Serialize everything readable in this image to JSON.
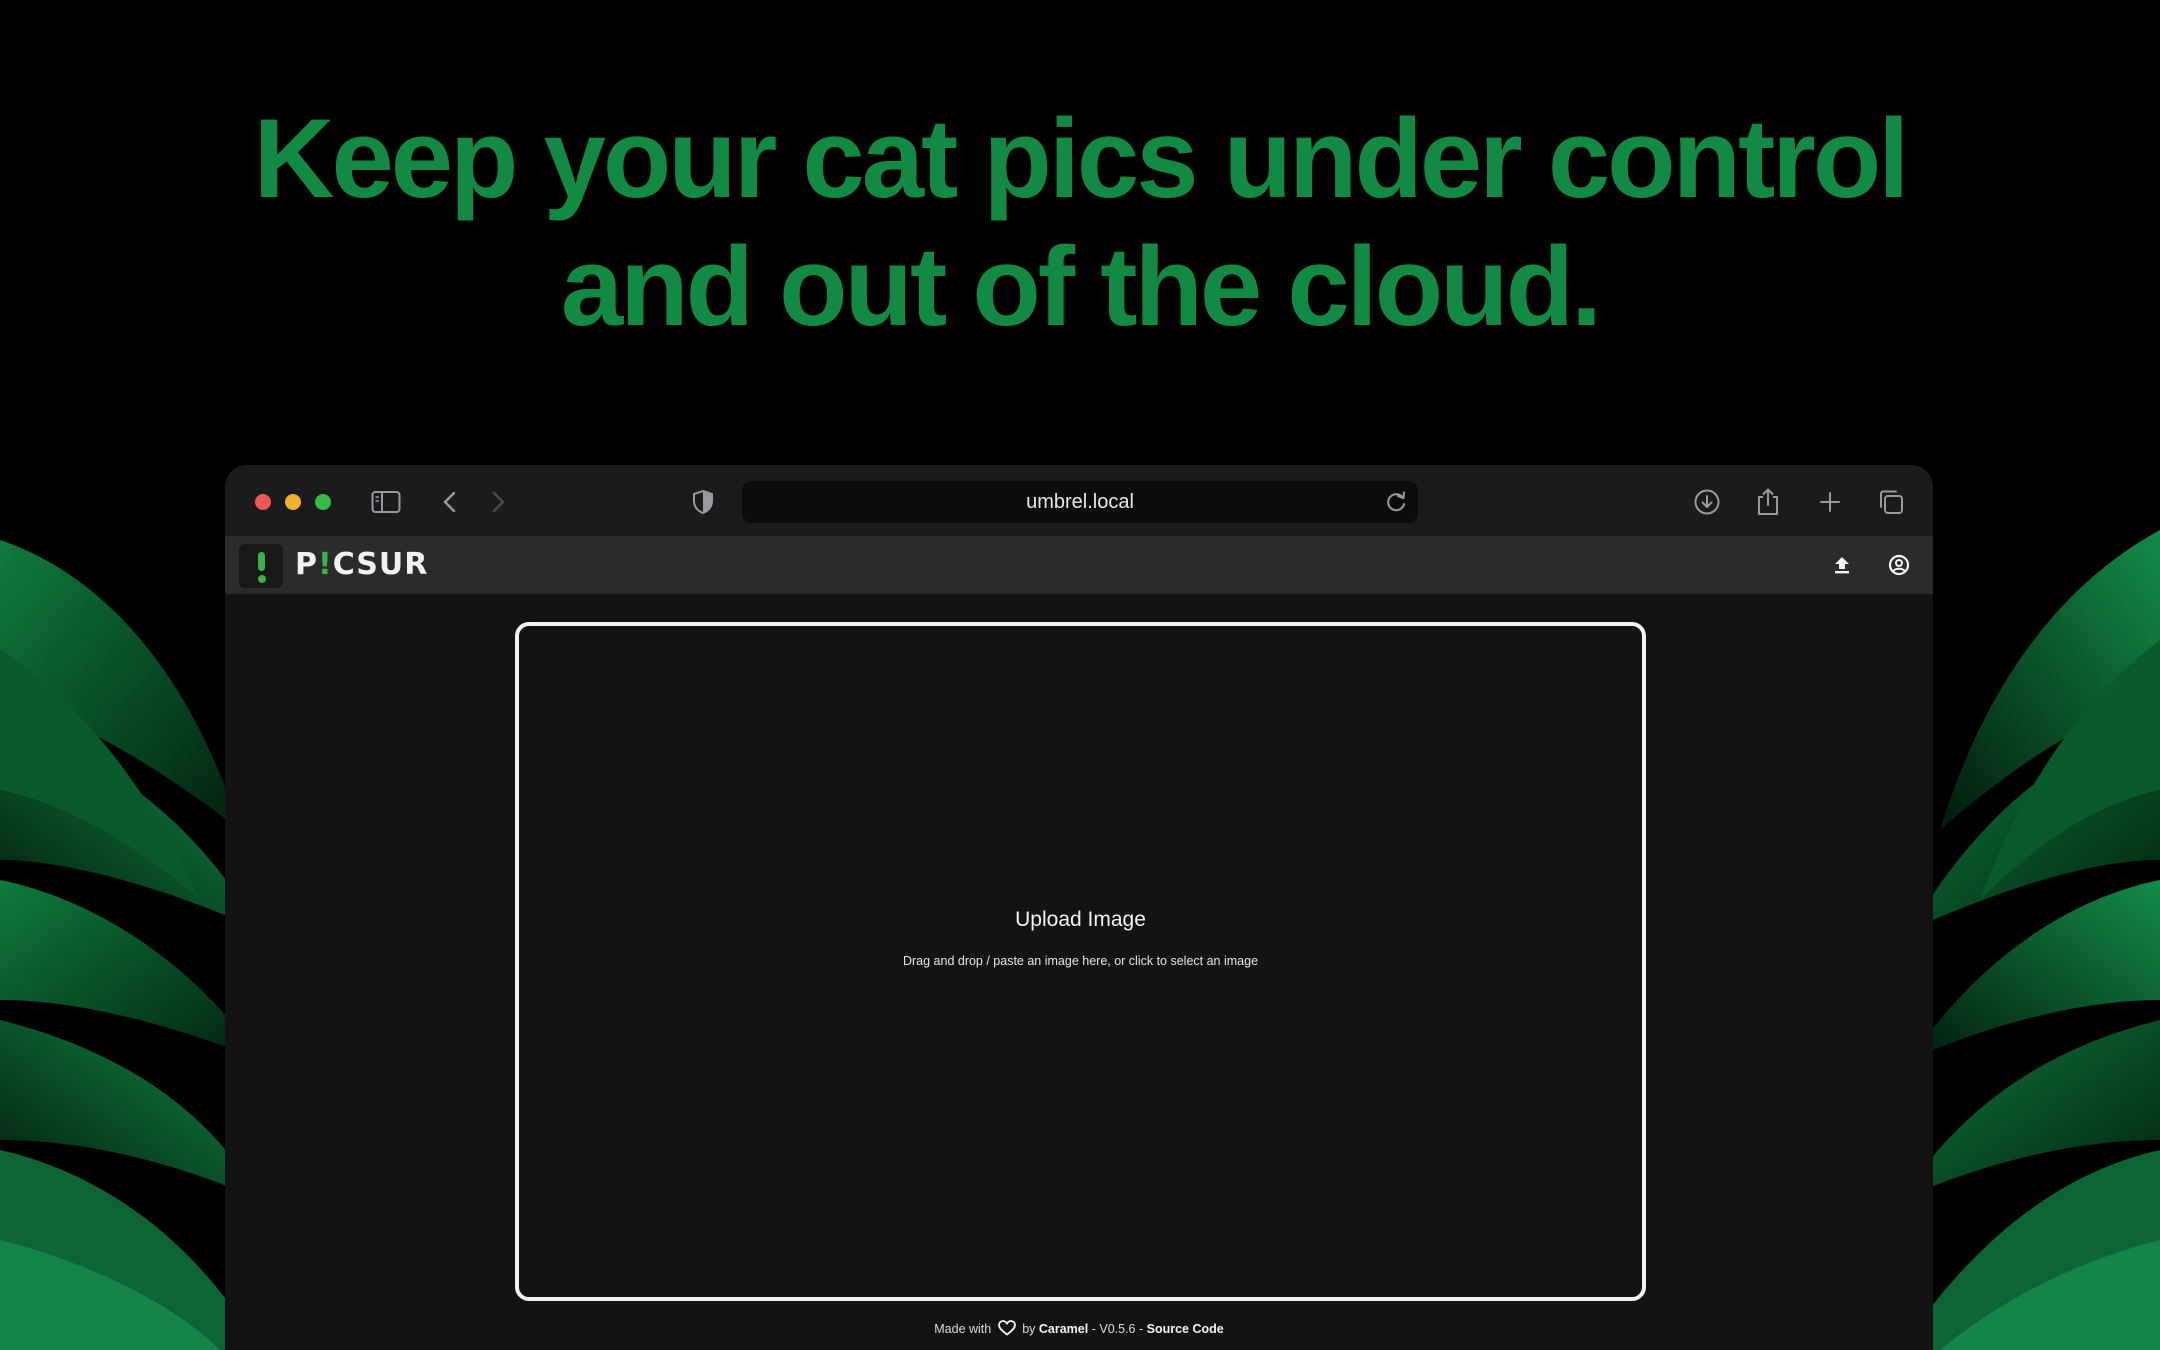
{
  "hero": {
    "line1": "Keep your cat pics under control",
    "line2": "and out of the cloud."
  },
  "browser": {
    "url": "umbrel.local",
    "icons": [
      "sidebar-icon",
      "back-icon",
      "forward-icon",
      "shield-icon",
      "reload-icon",
      "download-icon",
      "share-icon",
      "new-tab-icon",
      "tabs-overview-icon"
    ]
  },
  "app": {
    "logo_text_p": "P",
    "logo_text_i": "!",
    "logo_text_rest": "CSUR",
    "icons": [
      "upload-icon",
      "account-icon"
    ]
  },
  "upload": {
    "title": "Upload Image",
    "subtitle": "Drag and drop / paste an image here, or click to select an image"
  },
  "footer": {
    "made_with": "Made with",
    "by": "by",
    "author": "Caramel",
    "version": "- V0.5.6 -",
    "source": "Source Code"
  },
  "colors": {
    "hero_green": "#138a43",
    "brand_green": "#3bb34a"
  }
}
